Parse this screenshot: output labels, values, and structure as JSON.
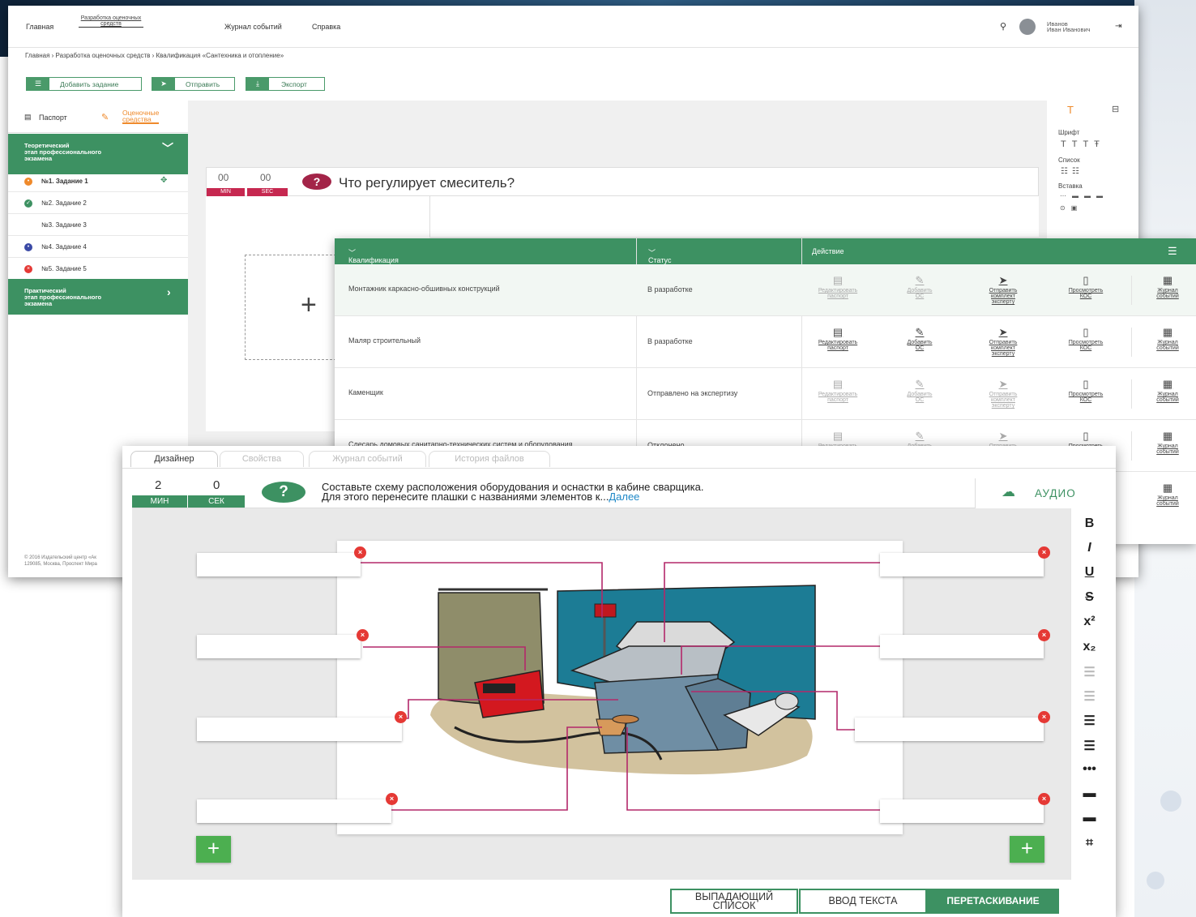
{
  "nav": {
    "items": [
      "Главная",
      "Разработка оценочных средств",
      "Журнал событий",
      "Справка"
    ],
    "user_last": "Иванов",
    "user_first": "Иван Иванович"
  },
  "breadcrumb": "Главная › Разработка оценочных средств › Квалификация «Сантехника и отопление»",
  "toolbar": {
    "add": "Добавить задание",
    "send": "Отправить",
    "export": "Экспорт"
  },
  "left": {
    "tab_passport": "Паспорт",
    "tab_eval_1": "Оценочные",
    "tab_eval_2": "средства",
    "sec1": [
      "Теоретический",
      "этап профессионального",
      "экзамена"
    ],
    "tasks": [
      "№1. Задание 1",
      "№2. Задание 2",
      "№3. Задание 3",
      "№4. Задание 4",
      "№5. Задание 5"
    ],
    "sec2": [
      "Практический",
      "этап профессионального",
      "экзамена"
    ],
    "footer": [
      "© 2016 Издательский центр «Ак",
      "129085, Москва, Проспект Мира"
    ]
  },
  "q1": {
    "min": "00",
    "sec": "00",
    "min_lbl": "MIN",
    "sec_lbl": "SEC",
    "text": "Что регулирует смеситель?"
  },
  "rpanel": {
    "font": "Шрифт",
    "list": "Список",
    "insert": "Вставка"
  },
  "table": {
    "h_qual": "Квалификация",
    "h_status": "Статус",
    "h_action": "Действие",
    "rows": [
      {
        "q": "Монтажник каркасно-обшивных конструкций",
        "s": "В разработке"
      },
      {
        "q": "Маляр строительный",
        "s": "В разработке"
      },
      {
        "q": "Каменщик",
        "s": "Отправлено на экспертизу"
      },
      {
        "q": "Слесарь домовых санитарно-технических систем и оборудования",
        "s": "Отклонено"
      }
    ],
    "a_edit": [
      "Редактировать",
      "паспорт"
    ],
    "a_add": [
      "Добавить",
      "ОС"
    ],
    "a_send": [
      "Отправить",
      "комплект",
      "эксперту"
    ],
    "a_view": [
      "Просмотреть",
      "КОС"
    ],
    "a_log": [
      "Журнал",
      "событий"
    ]
  },
  "designer": {
    "tabs": [
      "Дизайнер",
      "Свойства",
      "Журнал событий",
      "История файлов"
    ],
    "min": "2",
    "sec": "0",
    "min_lbl": "МИН",
    "sec_lbl": "СЕК",
    "q_line1": "Составьте схему расположения оборудования и оснастки в кабине сварщика.",
    "q_line2": "Для этого перенесите плашки с названиями элементов к...",
    "more": "Далее",
    "audio": "АУДИО",
    "modes": {
      "dropdown_1": "ВЫПАДАЮЩИЙ",
      "dropdown_2": "СПИСОК",
      "text": "ВВОД ТЕКСТА",
      "drag": "ПЕРЕТАСКИВАНИЕ"
    }
  },
  "colors": {
    "green": "#3d9162",
    "accent": "#ef8a2b",
    "red": "#e53935",
    "pink_line": "#b0306a"
  }
}
